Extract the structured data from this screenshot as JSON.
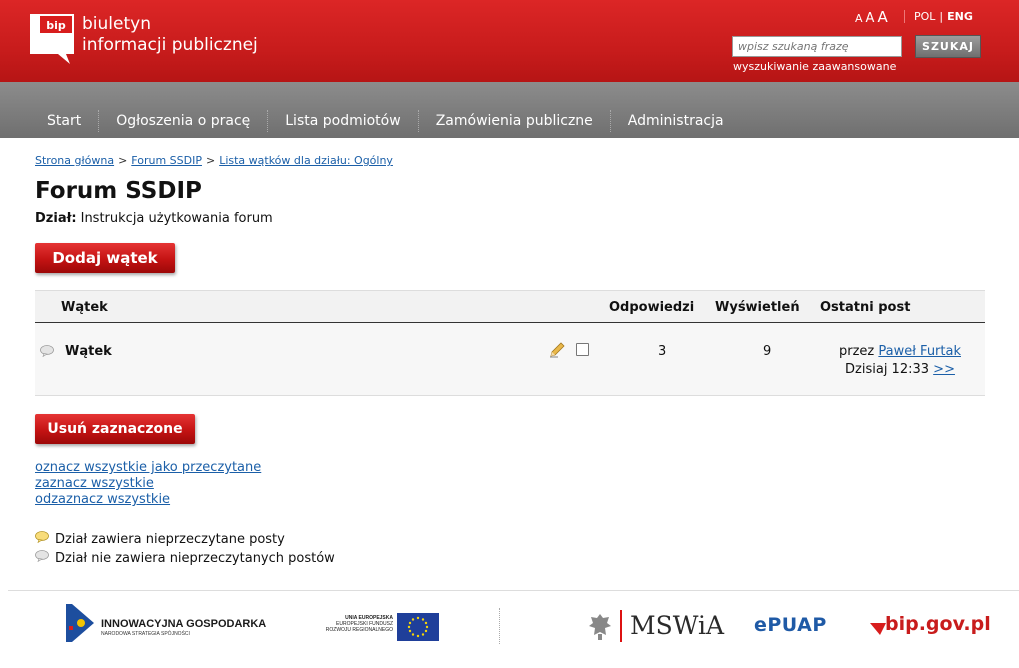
{
  "header": {
    "logo_badge": "bip",
    "logo_line1": "biuletyn",
    "logo_line2": "informacji publicznej",
    "font_sizes": [
      "A",
      "A",
      "A"
    ],
    "lang_pol": "POL",
    "lang_sep": "|",
    "lang_eng": "ENG",
    "search_placeholder": "wpisz szukaną frazę",
    "search_button": "SZUKAJ",
    "advanced_search": "wyszukiwanie zaawansowane"
  },
  "nav": {
    "items": [
      {
        "label": "Start"
      },
      {
        "label": "Ogłoszenia o pracę"
      },
      {
        "label": "Lista podmiotów"
      },
      {
        "label": "Zamówienia publiczne"
      },
      {
        "label": "Administracja"
      }
    ]
  },
  "breadcrumb": {
    "items": [
      "Strona główna",
      "Forum SSDIP",
      "Lista wątków dla działu: Ogólny"
    ],
    "separator": ">"
  },
  "page": {
    "title": "Forum SSDIP",
    "section_label": "Dział:",
    "section_value": "Instrukcja użytkowania forum",
    "add_thread_button": "Dodaj wątek",
    "delete_selected_button": "Usuń zaznaczone"
  },
  "table": {
    "headers": {
      "thread": "Wątek",
      "replies": "Odpowiedzi",
      "views": "Wyświetleń",
      "last_post": "Ostatni post"
    },
    "rows": [
      {
        "title": "Wątek",
        "replies": "3",
        "views": "9",
        "by_label": "przez",
        "author": "Paweł Furtak",
        "time": "Dzisiaj 12:33",
        "goto": ">>"
      }
    ]
  },
  "actions": {
    "mark_read": "oznacz wszystkie jako przeczytane",
    "select_all": "zaznacz wszystkie",
    "deselect_all": "odzaznacz wszystkie"
  },
  "legend": {
    "unread": "Dział zawiera nieprzeczytane posty",
    "read": "Dział nie zawiera nieprzeczytanych postów"
  },
  "footer": {
    "ig_line1": "INNOWACYJNA GOSPODARKA",
    "ig_line2": "NARODOWA STRATEGIA SPÓJNOŚCI",
    "eu_line1": "UNIA EUROPEJSKA",
    "eu_line2": "EUROPEJSKI FUNDUSZ",
    "eu_line3": "ROZWOJU REGIONALNEGO",
    "mswia": "MSWiA",
    "epuap": "ePUAP",
    "bipgov": "bip.gov.pl"
  },
  "colors": {
    "header_red": "#c81c1c",
    "nav_gray": "#7b7b7b",
    "link_blue": "#1b5fa8",
    "button_red": "#c41313"
  }
}
